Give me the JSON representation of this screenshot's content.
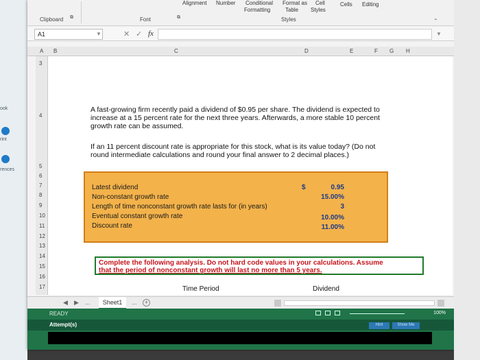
{
  "left_app": {
    "labels": [
      "ook",
      "rint",
      "rences"
    ]
  },
  "ribbon": {
    "clipboard": "Clipboard",
    "font": "Font",
    "alignment": "Alignment",
    "number": "Number",
    "conditional_formatting_1": "Conditional",
    "conditional_formatting_2": "Formatting",
    "format_as_1": "Format as",
    "format_as_2": "Table",
    "cell_styles_1": "Cell",
    "cell_styles_2": "Styles",
    "styles": "Styles",
    "cells": "Cells",
    "editing": "Editing"
  },
  "formula_bar": {
    "name_box": "A1",
    "fx": "fx"
  },
  "columns": [
    "A",
    "B",
    "C",
    "D",
    "E",
    "F",
    "G",
    "H"
  ],
  "rows": [
    "3",
    "4",
    "5",
    "6",
    "7",
    "8",
    "9",
    "10",
    "11",
    "12",
    "13",
    "14",
    "15",
    "16",
    "17"
  ],
  "problem": {
    "para1_line1": "A fast-growing firm recently paid a dividend of $0.95 per share. The dividend is expected to",
    "para1_line2": "increase at a 15 percent rate for the next three years. Afterwards, a more stable 10 percent",
    "para1_line3": "growth rate can be assumed.",
    "para2_line1": "If an 11 percent discount rate is appropriate for this stock, what is its value today? (Do not",
    "para2_line2": "round intermediate calculations and round your final answer to 2 decimal places.)"
  },
  "inputs": {
    "rows": [
      {
        "label": "Latest dividend",
        "value": "0.95"
      },
      {
        "label": "Non-constant growth rate",
        "value": "15.00%"
      },
      {
        "label": "Length of time nonconstant growth rate lasts for (in years)",
        "value": "3"
      },
      {
        "label": "Eventual constant growth rate",
        "value": "10.00%"
      },
      {
        "label": "Discount rate",
        "value": "11.00%"
      }
    ],
    "currency": "$"
  },
  "instruction": {
    "line1": "Complete the following analysis. Do not hard code values in your calculations. Assume",
    "line2": "that the period of nonconstant growth will last no more than 5 years."
  },
  "table_headers": {
    "time_period": "Time Period",
    "dividend": "Dividend"
  },
  "tabs": {
    "sheet1": "Sheet1",
    "add": "+",
    "ellipsis": "..."
  },
  "status": {
    "ready": "READY",
    "attempts": "Attempt(s)",
    "zoom": "100%",
    "hint": "Hint",
    "show_me": "Show Me"
  }
}
